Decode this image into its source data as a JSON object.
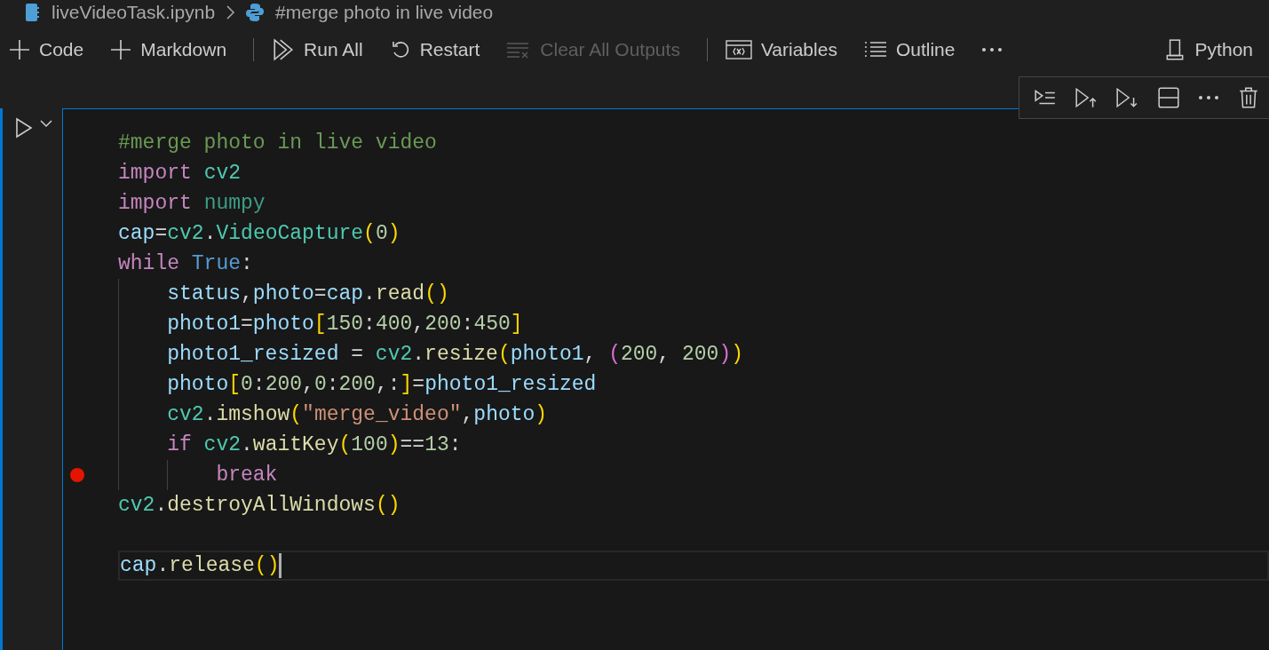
{
  "breadcrumb": [
    {
      "text": "liveVideoTask.ipynb",
      "kind": "notebook"
    },
    {
      "text": "#merge photo in live video",
      "kind": "python"
    }
  ],
  "toolbar": [
    {
      "kind": "add",
      "label": "Code",
      "disabled": false
    },
    {
      "kind": "add",
      "label": "Markdown",
      "disabled": false
    },
    {
      "kind": "separator"
    },
    {
      "kind": "run",
      "label": "Run All",
      "disabled": false
    },
    {
      "kind": "restart",
      "label": "Restart",
      "disabled": false
    },
    {
      "kind": "clear",
      "label": "Clear All Outputs",
      "disabled": true
    },
    {
      "kind": "separator"
    },
    {
      "kind": "variables",
      "label": "Variables",
      "disabled": false
    },
    {
      "kind": "outline",
      "label": "Outline",
      "disabled": false
    },
    {
      "kind": "more",
      "disabled": false
    }
  ],
  "kernel": {
    "label": "Python"
  },
  "cell_toolbar": [
    {
      "kind": "runline"
    },
    {
      "kind": "runabove"
    },
    {
      "kind": "runbelow"
    },
    {
      "kind": "split"
    },
    {
      "kind": "more"
    },
    {
      "kind": "delete"
    }
  ],
  "lines": [
    {
      "breakpoint": false,
      "current": false,
      "tokens": [
        {
          "text": "#merge photo in live video",
          "kind": "comment"
        }
      ]
    },
    {
      "breakpoint": false,
      "current": false,
      "tokens": [
        {
          "text": "import",
          "kind": "keyword"
        },
        {
          "text": " cv2",
          "kind": "module"
        }
      ]
    },
    {
      "breakpoint": false,
      "current": false,
      "tokens": [
        {
          "text": "import",
          "kind": "keyword"
        },
        {
          "text": " numpy",
          "kind": "unresolved"
        }
      ]
    },
    {
      "breakpoint": false,
      "current": false,
      "tokens": [
        {
          "text": "cap",
          "kind": "var"
        },
        {
          "text": "=",
          "kind": "plain"
        },
        {
          "text": "cv2",
          "kind": "module"
        },
        {
          "text": ".",
          "kind": "plain"
        },
        {
          "text": "VideoCapture",
          "kind": "module"
        },
        {
          "text": "(",
          "kind": "paren1"
        },
        {
          "text": "0",
          "kind": "number"
        },
        {
          "text": ")",
          "kind": "paren1"
        }
      ]
    },
    {
      "breakpoint": false,
      "current": false,
      "tokens": [
        {
          "text": "while",
          "kind": "keyword"
        },
        {
          "text": " True",
          "kind": "constant"
        },
        {
          "text": ":",
          "kind": "plain"
        }
      ],
      "children": [
        {
          "breakpoint": false,
          "current": false,
          "tokens": [
            {
              "text": "status",
              "kind": "var"
            },
            {
              "text": ",",
              "kind": "plain"
            },
            {
              "text": "photo",
              "kind": "var"
            },
            {
              "text": "=",
              "kind": "plain"
            },
            {
              "text": "cap",
              "kind": "var"
            },
            {
              "text": ".",
              "kind": "plain"
            },
            {
              "text": "read",
              "kind": "func"
            },
            {
              "text": "()",
              "kind": "paren1"
            }
          ]
        },
        {
          "breakpoint": false,
          "current": false,
          "tokens": [
            {
              "text": "photo1",
              "kind": "var"
            },
            {
              "text": "=",
              "kind": "plain"
            },
            {
              "text": "photo",
              "kind": "var"
            },
            {
              "text": "[",
              "kind": "paren1"
            },
            {
              "text": "150",
              "kind": "number"
            },
            {
              "text": ":",
              "kind": "plain"
            },
            {
              "text": "400",
              "kind": "number"
            },
            {
              "text": ",",
              "kind": "plain"
            },
            {
              "text": "200",
              "kind": "number"
            },
            {
              "text": ":",
              "kind": "plain"
            },
            {
              "text": "450",
              "kind": "number"
            },
            {
              "text": "]",
              "kind": "paren1"
            }
          ]
        },
        {
          "breakpoint": false,
          "current": false,
          "tokens": [
            {
              "text": "photo1_resized",
              "kind": "var"
            },
            {
              "text": " = ",
              "kind": "plain"
            },
            {
              "text": "cv2",
              "kind": "module"
            },
            {
              "text": ".",
              "kind": "plain"
            },
            {
              "text": "resize",
              "kind": "func"
            },
            {
              "text": "(",
              "kind": "paren1"
            },
            {
              "text": "photo1",
              "kind": "var"
            },
            {
              "text": ", ",
              "kind": "plain"
            },
            {
              "text": "(",
              "kind": "paren2"
            },
            {
              "text": "200",
              "kind": "number"
            },
            {
              "text": ", ",
              "kind": "plain"
            },
            {
              "text": "200",
              "kind": "number"
            },
            {
              "text": ")",
              "kind": "paren2"
            },
            {
              "text": ")",
              "kind": "paren1"
            }
          ]
        },
        {
          "breakpoint": false,
          "current": false,
          "tokens": [
            {
              "text": "photo",
              "kind": "var"
            },
            {
              "text": "[",
              "kind": "paren1"
            },
            {
              "text": "0",
              "kind": "number"
            },
            {
              "text": ":",
              "kind": "plain"
            },
            {
              "text": "200",
              "kind": "number"
            },
            {
              "text": ",",
              "kind": "plain"
            },
            {
              "text": "0",
              "kind": "number"
            },
            {
              "text": ":",
              "kind": "plain"
            },
            {
              "text": "200",
              "kind": "number"
            },
            {
              "text": ",:",
              "kind": "plain"
            },
            {
              "text": "]",
              "kind": "paren1"
            },
            {
              "text": "=",
              "kind": "plain"
            },
            {
              "text": "photo1_resized",
              "kind": "var"
            }
          ]
        },
        {
          "breakpoint": false,
          "current": false,
          "tokens": [
            {
              "text": "cv2",
              "kind": "module"
            },
            {
              "text": ".",
              "kind": "plain"
            },
            {
              "text": "imshow",
              "kind": "func"
            },
            {
              "text": "(",
              "kind": "paren1"
            },
            {
              "text": "\"merge_video\"",
              "kind": "string"
            },
            {
              "text": ",",
              "kind": "plain"
            },
            {
              "text": "photo",
              "kind": "var"
            },
            {
              "text": ")",
              "kind": "paren1"
            }
          ]
        },
        {
          "breakpoint": false,
          "current": false,
          "tokens": [
            {
              "text": "if",
              "kind": "keyword"
            },
            {
              "text": " cv2",
              "kind": "module"
            },
            {
              "text": ".",
              "kind": "plain"
            },
            {
              "text": "waitKey",
              "kind": "func"
            },
            {
              "text": "(",
              "kind": "paren1"
            },
            {
              "text": "100",
              "kind": "number"
            },
            {
              "text": ")",
              "kind": "paren1"
            },
            {
              "text": "==",
              "kind": "plain"
            },
            {
              "text": "13",
              "kind": "number"
            },
            {
              "text": ":",
              "kind": "plain"
            }
          ],
          "children": [
            {
              "breakpoint": true,
              "current": false,
              "tokens": [
                {
                  "text": "break",
                  "kind": "keyword"
                }
              ]
            }
          ]
        }
      ]
    },
    {
      "breakpoint": false,
      "current": false,
      "tokens": [
        {
          "text": "cv2",
          "kind": "module"
        },
        {
          "text": ".",
          "kind": "plain"
        },
        {
          "text": "destroyAllWindows",
          "kind": "func"
        },
        {
          "text": "()",
          "kind": "paren1"
        }
      ]
    },
    {
      "breakpoint": false,
      "current": false
    },
    {
      "breakpoint": false,
      "current": true,
      "tokens": [
        {
          "text": "cap",
          "kind": "var"
        },
        {
          "text": ".",
          "kind": "plain"
        },
        {
          "text": "release",
          "kind": "func"
        },
        {
          "text": "()",
          "kind": "paren1"
        }
      ]
    }
  ]
}
